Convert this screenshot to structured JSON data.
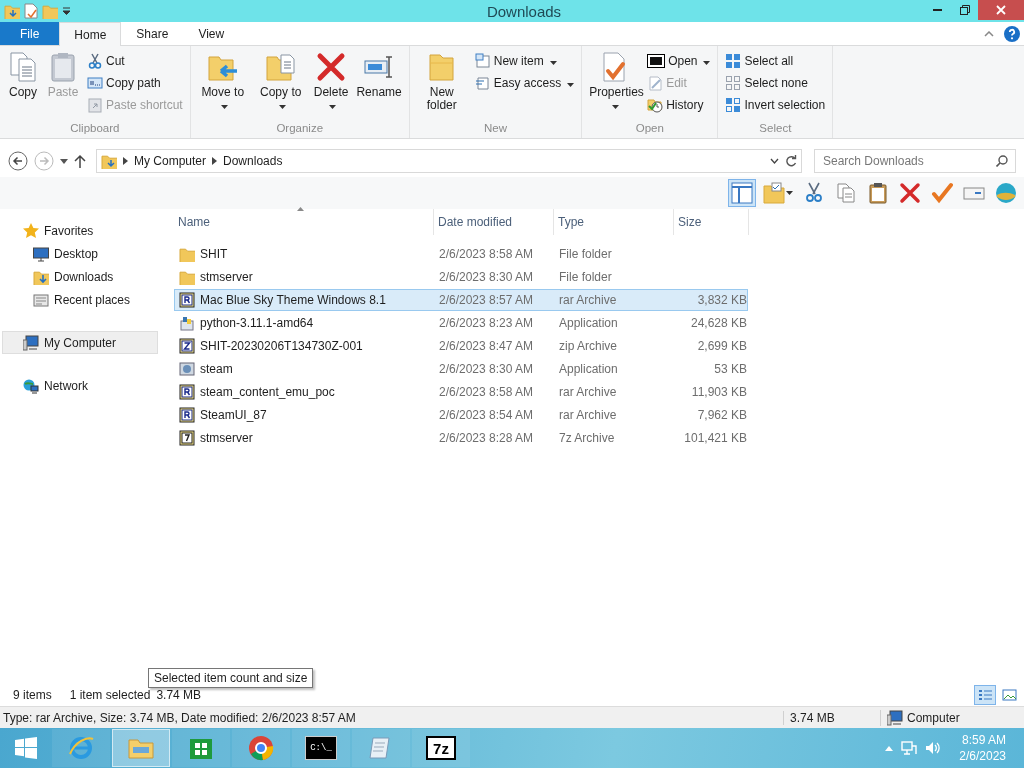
{
  "window": {
    "title": "Downloads"
  },
  "ribbon": {
    "tabs": [
      {
        "label": "File",
        "kind": "file",
        "selected": false
      },
      {
        "label": "Home",
        "kind": "tab",
        "selected": true
      },
      {
        "label": "Share",
        "kind": "tab",
        "selected": false
      },
      {
        "label": "View",
        "kind": "tab",
        "selected": false
      }
    ],
    "groups": [
      {
        "name": "Clipboard",
        "items": [
          {
            "label": "Copy",
            "kind": "large",
            "disabled": false,
            "dropdown": false
          },
          {
            "label": "Paste",
            "kind": "large",
            "disabled": true,
            "dropdown": false
          },
          {
            "label": "Cut",
            "kind": "small",
            "disabled": false,
            "dropdown": false
          },
          {
            "label": "Copy path",
            "kind": "small",
            "disabled": false,
            "dropdown": false
          },
          {
            "label": "Paste shortcut",
            "kind": "small",
            "disabled": true,
            "dropdown": false
          }
        ]
      },
      {
        "name": "Organize",
        "items": [
          {
            "label": "Move to",
            "kind": "large",
            "disabled": false,
            "dropdown": true
          },
          {
            "label": "Copy to",
            "kind": "large",
            "disabled": false,
            "dropdown": true
          },
          {
            "label": "Delete",
            "kind": "large",
            "disabled": false,
            "dropdown": true
          },
          {
            "label": "Rename",
            "kind": "large",
            "disabled": false,
            "dropdown": false
          }
        ]
      },
      {
        "name": "New",
        "items": [
          {
            "label": "New folder",
            "kind": "large",
            "disabled": false,
            "dropdown": false
          },
          {
            "label": "New item",
            "kind": "small",
            "disabled": false,
            "dropdown": true
          },
          {
            "label": "Easy access",
            "kind": "small",
            "disabled": false,
            "dropdown": true
          }
        ]
      },
      {
        "name": "Open",
        "items": [
          {
            "label": "Properties",
            "kind": "large",
            "disabled": false,
            "dropdown": true
          },
          {
            "label": "Open",
            "kind": "small",
            "disabled": false,
            "dropdown": true
          },
          {
            "label": "Edit",
            "kind": "small",
            "disabled": true,
            "dropdown": false
          },
          {
            "label": "History",
            "kind": "small",
            "disabled": false,
            "dropdown": false
          }
        ]
      },
      {
        "name": "Select",
        "items": [
          {
            "label": "Select all",
            "kind": "small",
            "disabled": false,
            "dropdown": false
          },
          {
            "label": "Select none",
            "kind": "small",
            "disabled": false,
            "dropdown": false
          },
          {
            "label": "Invert selection",
            "kind": "small",
            "disabled": false,
            "dropdown": false
          }
        ]
      }
    ]
  },
  "address": {
    "path": [
      "My Computer",
      "Downloads"
    ],
    "search_placeholder": "Search Downloads"
  },
  "toolbar": [
    {
      "selected": true
    },
    {
      "selected": false
    },
    {
      "selected": false
    },
    {
      "selected": false
    },
    {
      "selected": false
    },
    {
      "selected": false
    },
    {
      "selected": false
    },
    {
      "selected": false
    },
    {
      "selected": false
    }
  ],
  "navigation": [
    {
      "label": "Favorites",
      "kind": "favorites",
      "selected": false,
      "children": [
        {
          "label": "Desktop",
          "kind": "desktop",
          "selected": false
        },
        {
          "label": "Downloads",
          "kind": "downloads",
          "selected": false
        },
        {
          "label": "Recent places",
          "kind": "recent",
          "selected": false
        }
      ]
    },
    {
      "label": "My Computer",
      "kind": "computer",
      "selected": true
    },
    {
      "label": "Network",
      "kind": "network",
      "selected": false
    }
  ],
  "file_list": {
    "columns": [
      "Name",
      "Date modified",
      "Type",
      "Size"
    ],
    "rows": [
      {
        "name": "SHIT",
        "date": "2/6/2023 8:58 AM",
        "type": "File folder",
        "size": "",
        "kind": "folder",
        "selected": false
      },
      {
        "name": "stmserver",
        "date": "2/6/2023 8:30 AM",
        "type": "File folder",
        "size": "",
        "kind": "folder",
        "selected": false
      },
      {
        "name": "Mac Blue Sky Theme Windows 8.1",
        "date": "2/6/2023 8:57 AM",
        "type": "rar Archive",
        "size": "3,832 KB",
        "kind": "rar",
        "selected": true
      },
      {
        "name": "python-3.11.1-amd64",
        "date": "2/6/2023 8:23 AM",
        "type": "Application",
        "size": "24,628 KB",
        "kind": "python",
        "selected": false
      },
      {
        "name": "SHIT-20230206T134730Z-001",
        "date": "2/6/2023 8:47 AM",
        "type": "zip Archive",
        "size": "2,699 KB",
        "kind": "zip",
        "selected": false
      },
      {
        "name": "steam",
        "date": "2/6/2023 8:30 AM",
        "type": "Application",
        "size": "53 KB",
        "kind": "app",
        "selected": false
      },
      {
        "name": "steam_content_emu_poc",
        "date": "2/6/2023 8:58 AM",
        "type": "rar Archive",
        "size": "11,903 KB",
        "kind": "rar",
        "selected": false
      },
      {
        "name": "SteamUI_87",
        "date": "2/6/2023 8:54 AM",
        "type": "rar Archive",
        "size": "7,962 KB",
        "kind": "rar",
        "selected": false
      },
      {
        "name": "stmserver",
        "date": "2/6/2023 8:28 AM",
        "type": "7z Archive",
        "size": "101,421 KB",
        "kind": "sevenz",
        "selected": false
      }
    ]
  },
  "status": {
    "item_count": "9 items",
    "selection": "1 item selected",
    "selection_size": "3.74 MB",
    "tooltip": "Selected item count and size",
    "views": [
      {
        "selected": true
      },
      {
        "selected": false
      }
    ]
  },
  "details_bar": {
    "description": "Type: rar Archive, Size: 3.74 MB, Date modified: 2/6/2023 8:57 AM",
    "size": "3.74 MB",
    "location": "Computer"
  },
  "taskbar": {
    "apps": [
      {
        "kind": "ie",
        "selected": false
      },
      {
        "kind": "explorer",
        "selected": true
      },
      {
        "kind": "store",
        "selected": false
      },
      {
        "kind": "chrome",
        "selected": false
      },
      {
        "kind": "cmd",
        "label": "C:\\_",
        "selected": false
      },
      {
        "kind": "notepad",
        "selected": false
      },
      {
        "kind": "sevenzip",
        "label": "7z",
        "selected": false
      }
    ],
    "time": "8:59 AM",
    "date": "2/6/2023"
  }
}
